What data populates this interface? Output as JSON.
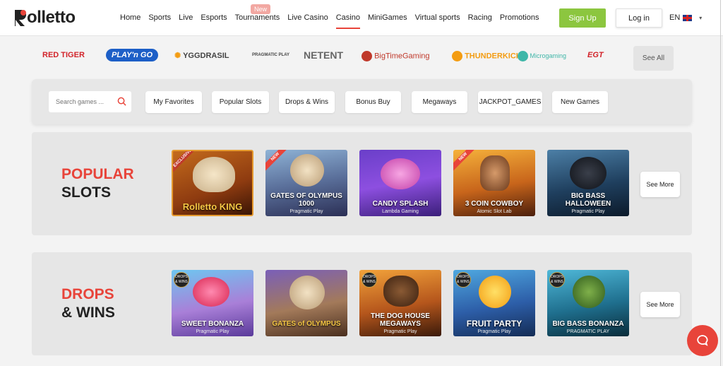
{
  "header": {
    "logo_text": "olletto",
    "nav": [
      "Home",
      "Sports",
      "Live",
      "Esports",
      "Tournaments",
      "Live Casino",
      "Casino",
      "MiniGames",
      "Virtual sports",
      "Racing",
      "Promotions"
    ],
    "active_nav": "Casino",
    "new_badge": "New",
    "signup_label": "Sign Up",
    "login_label": "Log in",
    "language": "EN"
  },
  "providers": {
    "items": [
      "RED TIGER",
      "PLAY'n GO",
      "YGGDRASIL",
      "PRAGMATIC PLAY",
      "NETENT",
      "BigTimeGaming",
      "THUNDERKICK",
      "Microgaming",
      "EGT"
    ],
    "see_all_label": "See All"
  },
  "filters": {
    "search_placeholder": "Search games ...",
    "chips": [
      "My Favorites",
      "Popular Slots",
      "Drops & Wins",
      "Bonus Buy",
      "Megaways",
      "JACKPOT_GAMES",
      "New Games"
    ]
  },
  "sections": [
    {
      "title_line1": "POPULAR",
      "title_line2": "SLOTS",
      "see_more_label": "See More",
      "games": [
        {
          "name": "Rolletto KING",
          "provider": "",
          "tag": "EXCLUSIVE"
        },
        {
          "name": "GATES OF OLYMPUS 1000",
          "provider": "Pragmatic Play",
          "tag": "NEW"
        },
        {
          "name": "CANDY SPLASH",
          "provider": "Lambda Gaming",
          "tag": ""
        },
        {
          "name": "3 COIN COWBOY",
          "provider": "Atomic Slot Lab",
          "tag": "NEW"
        },
        {
          "name": "BIG BASS HALLOWEEN",
          "provider": "Pragmatic Play",
          "tag": ""
        }
      ]
    },
    {
      "title_line1": "DROPS",
      "title_line2": "& WINS",
      "see_more_label": "See More",
      "games": [
        {
          "name": "SWEET BONANZA",
          "provider": "Pragmatic Play",
          "tag": "DROPS & WINS"
        },
        {
          "name": "GATES of OLYMPUS",
          "provider": "",
          "tag": ""
        },
        {
          "name": "THE DOG HOUSE MEGAWAYS",
          "provider": "Pragmatic Play",
          "tag": "DROPS & WINS"
        },
        {
          "name": "FRUIT PARTY",
          "provider": "Pragmatic Play",
          "tag": "DROPS & WINS"
        },
        {
          "name": "BIG BASS BONANZA",
          "provider": "PRAGMATIC PLAY",
          "tag": "DROPS & WINS"
        }
      ]
    }
  ],
  "colors": {
    "accent": "#e8443a",
    "signup": "#8cc63f"
  }
}
